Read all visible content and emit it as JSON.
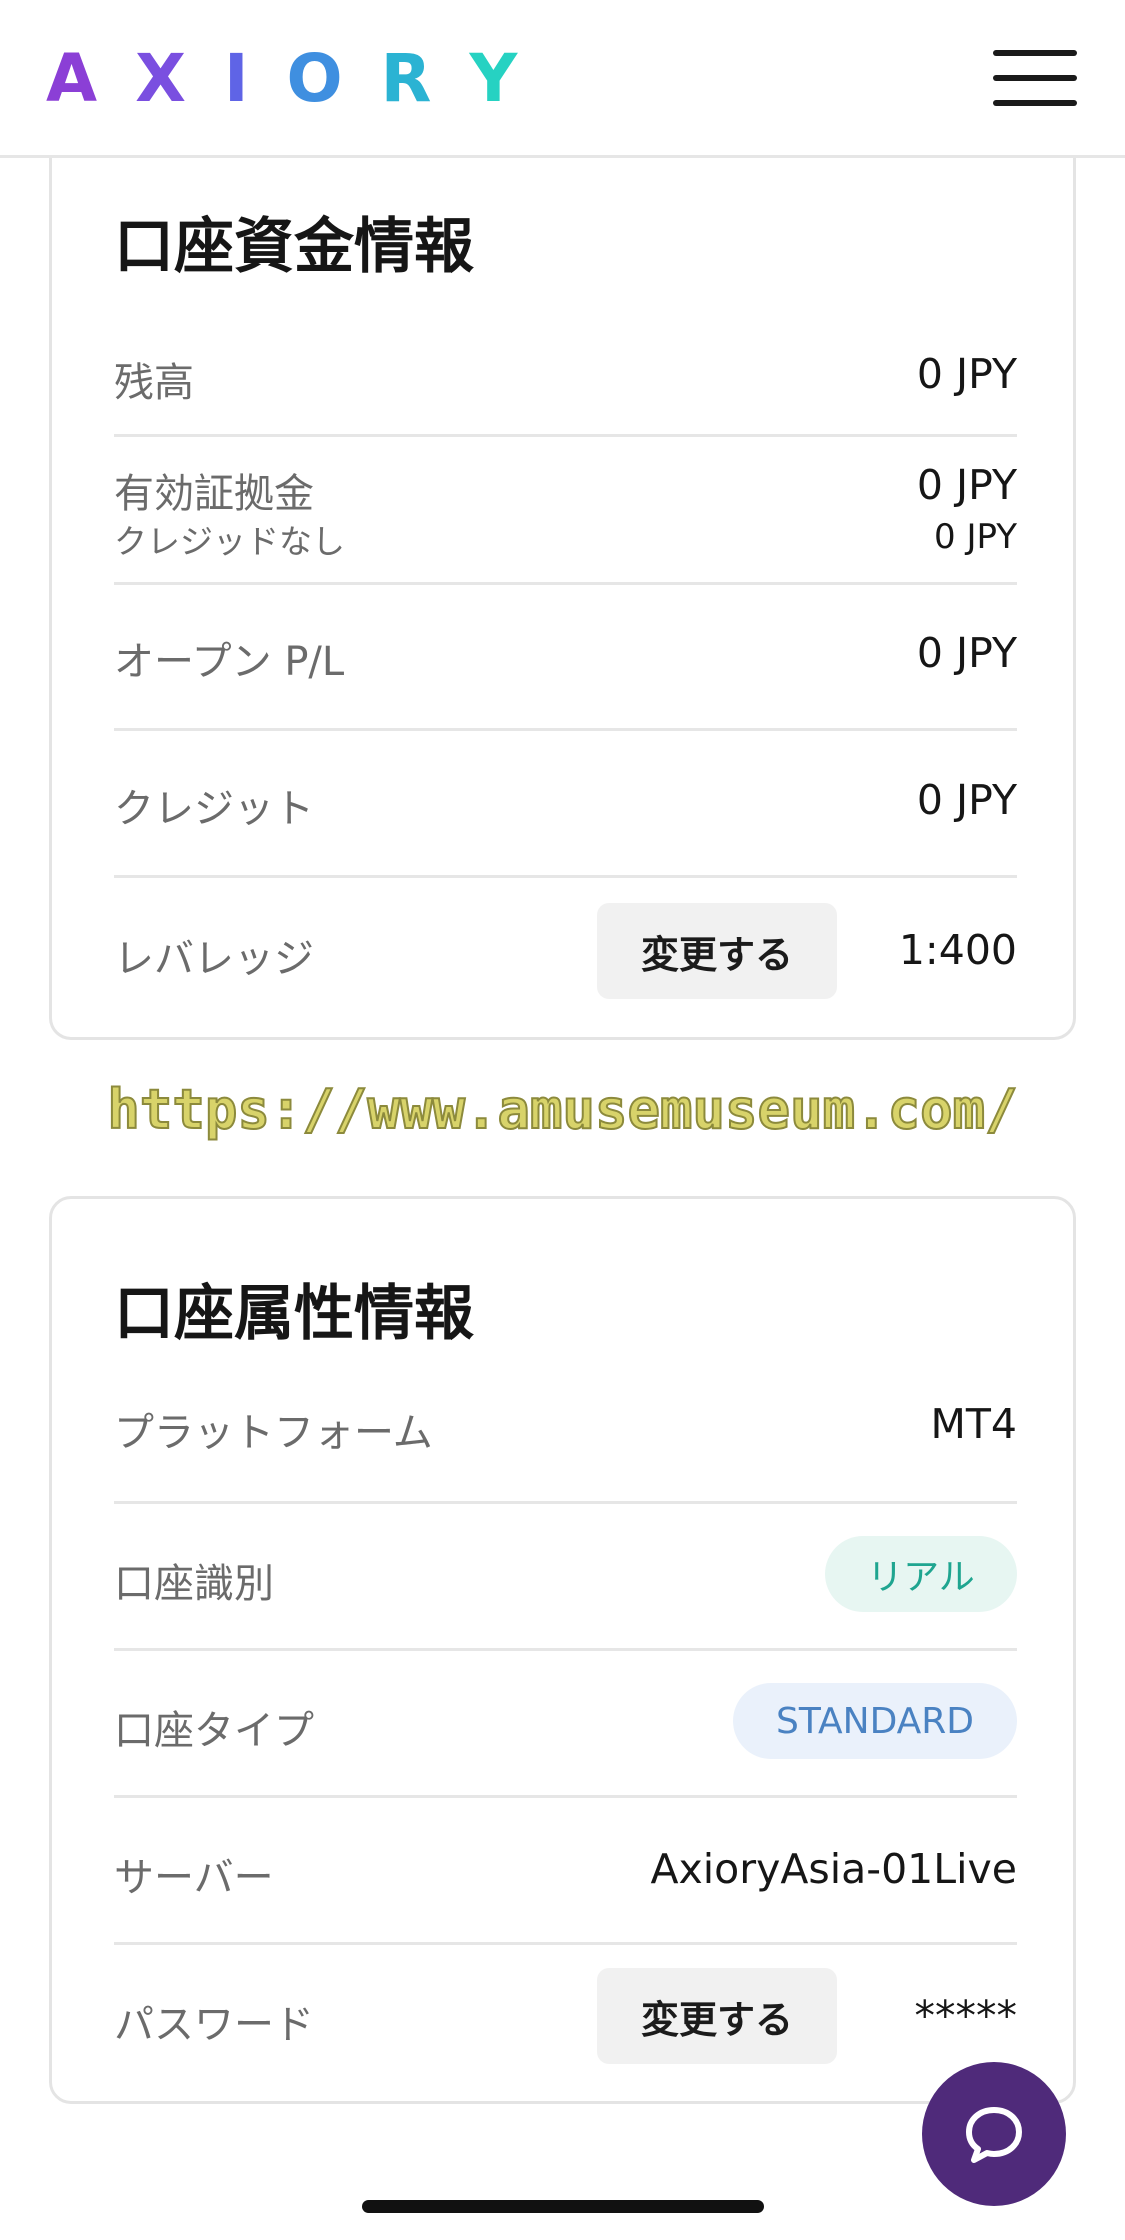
{
  "header": {
    "logo_letters": [
      "A",
      "X",
      "I",
      "O",
      "R",
      "Y"
    ],
    "logo_colors": [
      "#8b3fd6",
      "#7a4fe0",
      "#5f64e6",
      "#3f8fe0",
      "#2bb3d3",
      "#26d2c2"
    ],
    "menu_icon": "hamburger-menu-icon"
  },
  "funds": {
    "title": "口座資金情報",
    "balance": {
      "label": "残高",
      "value": "0 JPY"
    },
    "margin": {
      "label": "有効証拠金",
      "sublabel": "クレジッドなし",
      "value": "0 JPY",
      "subvalue": "0 JPY"
    },
    "open_pl": {
      "label": "オープン P/L",
      "value": "0 JPY"
    },
    "credit": {
      "label": "クレジット",
      "value": "0 JPY"
    },
    "leverage": {
      "label": "レバレッジ",
      "button": "変更する",
      "value": "1:400"
    }
  },
  "watermark": "https://www.amusemuseum.com/",
  "attributes": {
    "title": "口座属性情報",
    "platform": {
      "label": "プラットフォーム",
      "value": "MT4"
    },
    "account_class": {
      "label": "口座識別",
      "value": "リアル",
      "color": "#1fa590"
    },
    "account_type": {
      "label": "口座タイプ",
      "value": "STANDARD",
      "color": "#4a82c2"
    },
    "server": {
      "label": "サーバー",
      "value": "AxioryAsia-01Live"
    },
    "password": {
      "label": "パスワード",
      "button": "変更する",
      "value": "*****"
    }
  },
  "chat": {
    "icon": "chat-bubble-icon",
    "color": "#4f2a7a"
  }
}
